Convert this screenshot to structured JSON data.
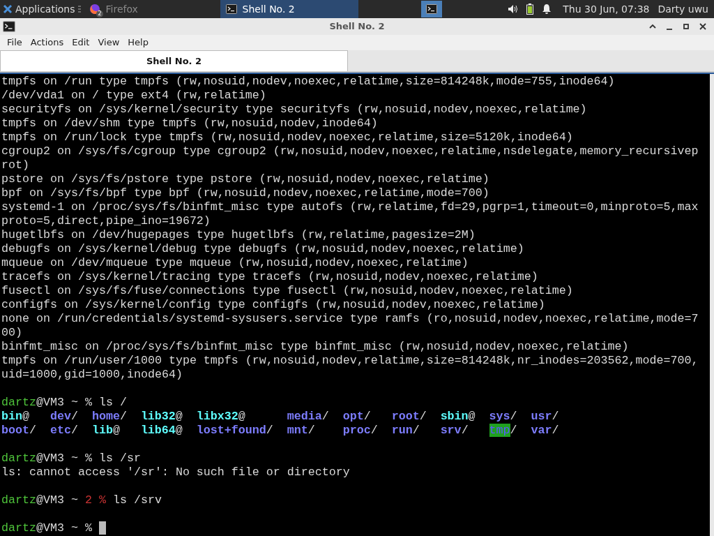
{
  "panel": {
    "menu_label": "Applications",
    "tasks": [
      {
        "label": "Firefox",
        "badge": "2",
        "selected": false,
        "kind": "browser"
      },
      {
        "label": "Shell No. 2",
        "selected": true,
        "kind": "terminal"
      }
    ],
    "clock": "Thu 30 Jun, 07:38",
    "user": "Darty uwu"
  },
  "window": {
    "title": "Shell No. 2"
  },
  "menu": [
    "File",
    "Actions",
    "Edit",
    "View",
    "Help"
  ],
  "tabs": [
    {
      "label": "Shell No. 2",
      "selected": true
    }
  ],
  "terminal": {
    "blocks": [
      {
        "kind": "output",
        "text": "tmpfs on /run type tmpfs (rw,nosuid,nodev,noexec,relatime,size=814248k,mode=755,inode64)"
      },
      {
        "kind": "output",
        "text": "/dev/vda1 on / type ext4 (rw,relatime)"
      },
      {
        "kind": "output",
        "text": "securityfs on /sys/kernel/security type securityfs (rw,nosuid,nodev,noexec,relatime)"
      },
      {
        "kind": "output",
        "text": "tmpfs on /dev/shm type tmpfs (rw,nosuid,nodev,inode64)"
      },
      {
        "kind": "output",
        "text": "tmpfs on /run/lock type tmpfs (rw,nosuid,nodev,noexec,relatime,size=5120k,inode64)"
      },
      {
        "kind": "output",
        "text": "cgroup2 on /sys/fs/cgroup type cgroup2 (rw,nosuid,nodev,noexec,relatime,nsdelegate,memory_recursivep"
      },
      {
        "kind": "output",
        "text": "rot)"
      },
      {
        "kind": "output",
        "text": "pstore on /sys/fs/pstore type pstore (rw,nosuid,nodev,noexec,relatime)"
      },
      {
        "kind": "output",
        "text": "bpf on /sys/fs/bpf type bpf (rw,nosuid,nodev,noexec,relatime,mode=700)"
      },
      {
        "kind": "output",
        "text": "systemd-1 on /proc/sys/fs/binfmt_misc type autofs (rw,relatime,fd=29,pgrp=1,timeout=0,minproto=5,max"
      },
      {
        "kind": "output",
        "text": "proto=5,direct,pipe_ino=19672)"
      },
      {
        "kind": "output",
        "text": "hugetlbfs on /dev/hugepages type hugetlbfs (rw,relatime,pagesize=2M)"
      },
      {
        "kind": "output",
        "text": "debugfs on /sys/kernel/debug type debugfs (rw,nosuid,nodev,noexec,relatime)"
      },
      {
        "kind": "output",
        "text": "mqueue on /dev/mqueue type mqueue (rw,nosuid,nodev,noexec,relatime)"
      },
      {
        "kind": "output",
        "text": "tracefs on /sys/kernel/tracing type tracefs (rw,nosuid,nodev,noexec,relatime)"
      },
      {
        "kind": "output",
        "text": "fusectl on /sys/fs/fuse/connections type fusectl (rw,nosuid,nodev,noexec,relatime)"
      },
      {
        "kind": "output",
        "text": "configfs on /sys/kernel/config type configfs (rw,nosuid,nodev,noexec,relatime)"
      },
      {
        "kind": "output",
        "text": "none on /run/credentials/systemd-sysusers.service type ramfs (ro,nosuid,nodev,noexec,relatime,mode=7"
      },
      {
        "kind": "output",
        "text": "00)"
      },
      {
        "kind": "output",
        "text": "binfmt_misc on /proc/sys/fs/binfmt_misc type binfmt_misc (rw,nosuid,nodev,noexec,relatime)"
      },
      {
        "kind": "output",
        "text": "tmpfs on /run/user/1000 type tmpfs (rw,nosuid,nodev,relatime,size=814248k,nr_inodes=203562,mode=700,"
      },
      {
        "kind": "output",
        "text": "uid=1000,gid=1000,inode64)"
      },
      {
        "kind": "blank"
      },
      {
        "kind": "prompt",
        "user": "dartz",
        "host": "@VM3",
        "cwd": "~",
        "symbol": "%",
        "command": "ls /",
        "cursor": false
      },
      {
        "kind": "ls",
        "rows": [
          [
            {
              "name": "bin",
              "indicator": "@",
              "kind": "link"
            },
            {
              "name": "dev",
              "indicator": "/",
              "kind": "dir"
            },
            {
              "name": "home",
              "indicator": "/",
              "kind": "dir"
            },
            {
              "name": "lib32",
              "indicator": "@",
              "kind": "link"
            },
            {
              "name": "libx32",
              "indicator": "@",
              "kind": "link"
            },
            {
              "name": "media",
              "indicator": "/",
              "kind": "dir"
            },
            {
              "name": "opt",
              "indicator": "/",
              "kind": "dir"
            },
            {
              "name": "root",
              "indicator": "/",
              "kind": "dir"
            },
            {
              "name": "sbin",
              "indicator": "@",
              "kind": "link"
            },
            {
              "name": "sys",
              "indicator": "/",
              "kind": "dir"
            },
            {
              "name": "usr",
              "indicator": "/",
              "kind": "dir"
            }
          ],
          [
            {
              "name": "boot",
              "indicator": "/",
              "kind": "dir"
            },
            {
              "name": "etc",
              "indicator": "/",
              "kind": "dir"
            },
            {
              "name": "lib",
              "indicator": "@",
              "kind": "link"
            },
            {
              "name": "lib64",
              "indicator": "@",
              "kind": "link"
            },
            {
              "name": "lost+found",
              "indicator": "/",
              "kind": "dir"
            },
            {
              "name": "mnt",
              "indicator": "/",
              "kind": "dir"
            },
            {
              "name": "proc",
              "indicator": "/",
              "kind": "dir"
            },
            {
              "name": "run",
              "indicator": "/",
              "kind": "dir"
            },
            {
              "name": "srv",
              "indicator": "/",
              "kind": "dir"
            },
            {
              "name": "tmp",
              "indicator": "/",
              "kind": "sticky"
            },
            {
              "name": "var",
              "indicator": "/",
              "kind": "dir"
            }
          ]
        ]
      },
      {
        "kind": "blank"
      },
      {
        "kind": "prompt",
        "user": "dartz",
        "host": "@VM3",
        "cwd": "~",
        "symbol": "%",
        "command": "ls /sr",
        "cursor": false
      },
      {
        "kind": "output",
        "text": "ls: cannot access '/sr': No such file or directory"
      },
      {
        "kind": "blank"
      },
      {
        "kind": "prompt",
        "user": "dartz",
        "host": "@VM3",
        "cwd": "~",
        "status": "2",
        "symbol": "%",
        "command": "ls /srv",
        "cursor": false
      },
      {
        "kind": "blank"
      },
      {
        "kind": "prompt",
        "user": "dartz",
        "host": "@VM3",
        "cwd": "~",
        "symbol": "%",
        "cursor": true
      }
    ]
  }
}
